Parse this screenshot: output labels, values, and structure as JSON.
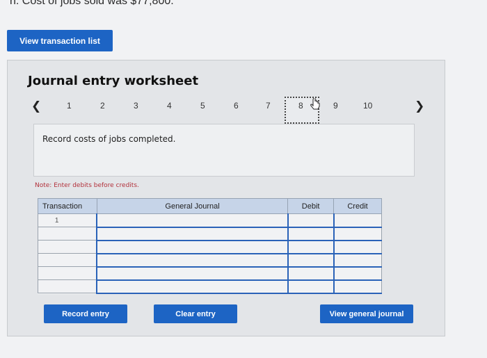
{
  "header": {
    "question_line": "h. Cost of jobs sold was $77,800."
  },
  "top_button": {
    "label": "View transaction list"
  },
  "worksheet": {
    "title": "Journal entry worksheet",
    "nav": {
      "prev_icon": "chevron-left-icon",
      "next_icon": "chevron-right-icon",
      "pages": [
        "1",
        "2",
        "3",
        "4",
        "5",
        "6",
        "7",
        "8",
        "9",
        "10"
      ],
      "selected": "8"
    },
    "instruction": "Record costs of jobs completed.",
    "note": "Note: Enter debits before credits.",
    "table": {
      "headers": [
        "Transaction",
        "General Journal",
        "Debit",
        "Credit"
      ],
      "rows": [
        [
          "1",
          "",
          "",
          ""
        ],
        [
          "",
          "",
          "",
          ""
        ],
        [
          "",
          "",
          "",
          ""
        ],
        [
          "",
          "",
          "",
          ""
        ],
        [
          "",
          "",
          "",
          ""
        ],
        [
          "",
          "",
          "",
          ""
        ]
      ]
    },
    "buttons": {
      "record": "Record entry",
      "clear": "Clear entry",
      "view_journal": "View general journal"
    }
  }
}
